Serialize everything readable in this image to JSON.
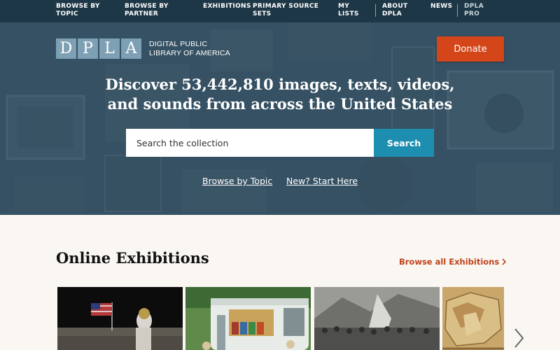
{
  "nav": {
    "items": [
      {
        "id": "browse-topic",
        "label": "Browse by Topic"
      },
      {
        "id": "browse-partner",
        "label": "Browse by Partner"
      },
      {
        "id": "exhibitions",
        "label": "Exhibitions"
      },
      {
        "id": "primary-source-sets",
        "label": "Primary Source Sets"
      },
      {
        "id": "my-lists",
        "label": "My Lists"
      },
      {
        "id": "about-dpla",
        "label": "About DPLA"
      },
      {
        "id": "news",
        "label": "News"
      },
      {
        "id": "dpla-pro",
        "label": "DPLA Pro"
      }
    ]
  },
  "hero": {
    "logo_letters": [
      "D",
      "P",
      "L",
      "A"
    ],
    "logo_text": "DIGITAL PUBLIC LIBRARY OF AMERICA",
    "donate_label": "Donate",
    "headline": "Discover 53,442,810 images, texts, videos, and sounds from across the United States",
    "search_placeholder": "Search the collection",
    "search_button": "Search",
    "links": [
      "Browse by Topic",
      "New? Start Here"
    ]
  },
  "exhibitions": {
    "title": "Online Exhibitions",
    "browse_all": "Browse all Exhibitions",
    "cards": [
      {
        "id": "moon-landing"
      },
      {
        "id": "county-library-bus"
      },
      {
        "id": "historic-crowd"
      },
      {
        "id": "historic-map"
      }
    ]
  },
  "colors": {
    "nav_bg": "#1d3746",
    "hero_overlay": "#244052",
    "donate": "#d4461a",
    "search_button": "#1e8eb0",
    "accent_link": "#c0421a"
  }
}
